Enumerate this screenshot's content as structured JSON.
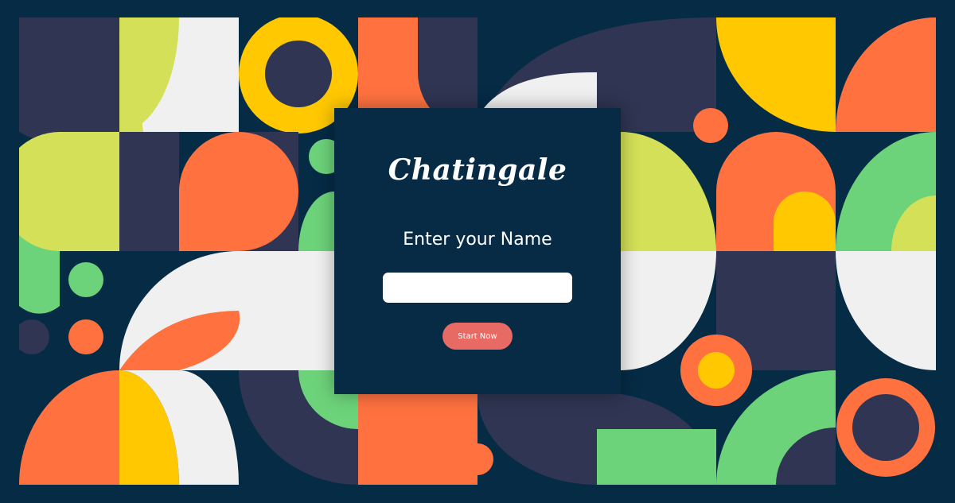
{
  "app": {
    "brand_title": "Chatingale"
  },
  "form": {
    "prompt_label": "Enter your Name",
    "name_input_value": "",
    "name_input_placeholder": "",
    "submit_label": "Start Now"
  },
  "colors": {
    "page_background": "#052b45",
    "card_background": "#082b45",
    "button": "#e86a64",
    "accent_orange": "#ff7240",
    "accent_yellow": "#ffc800",
    "accent_green": "#6dd37a",
    "accent_lime": "#d4e057",
    "accent_navy": "#2f3552",
    "accent_white": "#f0f0f0"
  }
}
